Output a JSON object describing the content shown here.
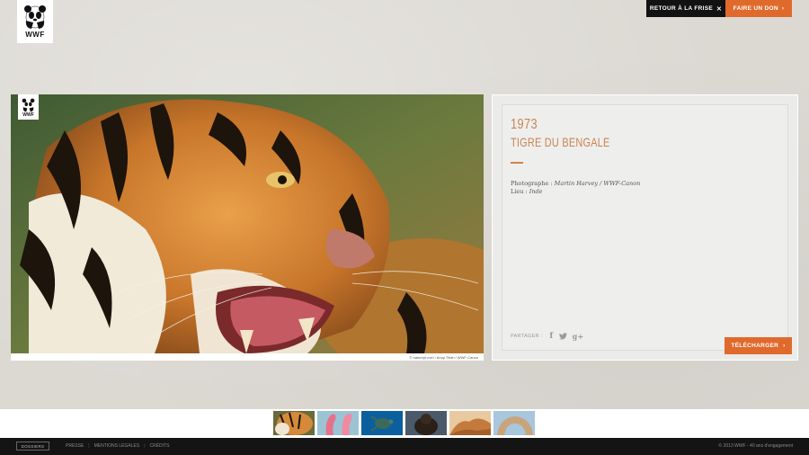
{
  "logo": {
    "text": "WWF"
  },
  "header": {
    "back_label": "RETOUR À LA FRISE",
    "back_icon": "close-icon",
    "donate_label": "FAIRE UN DON",
    "donate_icon": "chevron-right-icon"
  },
  "photo": {
    "badge_text": "WWF",
    "credit": "© naturepl.com / Anup Shah / WWF-Canon"
  },
  "info": {
    "year": "1973",
    "title": "TIGRE DU BENGALE",
    "photographer_label": "Photographe :",
    "photographer": "Martin Harvey / WWF-Canon",
    "place_label": "Lieu :",
    "place": "Inde"
  },
  "share": {
    "label": "PARTAGER :",
    "facebook": "f",
    "twitter_icon": "twitter-icon",
    "google": "g+"
  },
  "download": {
    "label": "TÉLÉCHARGER"
  },
  "thumbnails": [
    {
      "name": "tiger",
      "active": true
    },
    {
      "name": "flamingo"
    },
    {
      "name": "sea-turtle"
    },
    {
      "name": "bear"
    },
    {
      "name": "dunes"
    },
    {
      "name": "rock-arch"
    }
  ],
  "footer": {
    "dossiers": "DOSSIERS",
    "links": [
      "PRESSE",
      "MENTIONS LÉGALES",
      "CRÉDITS"
    ],
    "copyright": "© 2013 WWF - 40 ans d'engagement"
  },
  "colors": {
    "accent": "#e06a2c",
    "title": "#c9844f",
    "dark": "#121212"
  }
}
